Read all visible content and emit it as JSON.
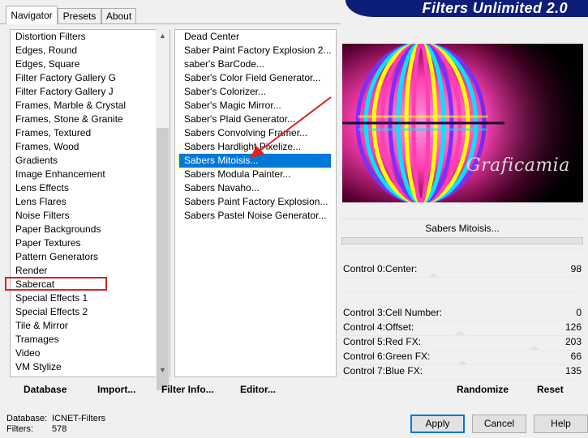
{
  "tabs": [
    "Navigator",
    "Presets",
    "About"
  ],
  "banner": "Filters Unlimited 2.0",
  "categories": [
    "Distortion Filters",
    "Edges, Round",
    "Edges, Square",
    "Filter Factory Gallery G",
    "Filter Factory Gallery J",
    "Frames, Marble & Crystal",
    "Frames, Stone & Granite",
    "Frames, Textured",
    "Frames, Wood",
    "Gradients",
    "Image Enhancement",
    "Lens Effects",
    "Lens Flares",
    "Noise Filters",
    "Paper Backgrounds",
    "Paper Textures",
    "Pattern Generators",
    "Render",
    "Sabercat",
    "Special Effects 1",
    "Special Effects 2",
    "Tile & Mirror",
    "Tramages",
    "Video",
    "VM Stylize"
  ],
  "filters": [
    "Dead Center",
    "Saber Paint Factory Explosion 2...",
    "saber's BarCode...",
    "Saber's Color Field Generator...",
    "Saber's Colorizer...",
    "Saber's Magic Mirror...",
    "Saber's Plaid Generator...",
    "Sabers Convolving Framer...",
    "Sabers Hardlight Pixelize...",
    "Sabers Mitoisis...",
    "Sabers Modula Painter...",
    "Sabers Navaho...",
    "Sabers Paint Factory Explosion...",
    "Sabers Pastel Noise Generator..."
  ],
  "selected_filter_index": 9,
  "highlighted_category": "Sabercat",
  "buttons": {
    "database": "Database",
    "import": "Import...",
    "filter_info": "Filter Info...",
    "editor": "Editor...",
    "randomize": "Randomize",
    "reset": "Reset",
    "apply": "Apply",
    "cancel": "Cancel",
    "help": "Help"
  },
  "filter_name": "Sabers Mitoisis...",
  "watermark": "Graficamia",
  "controls": [
    {
      "label": "Control 0:Center:",
      "value": "98"
    },
    {
      "label": "Control 3:Cell Number:",
      "value": "0"
    },
    {
      "label": "Control 4:Offset:",
      "value": "126"
    },
    {
      "label": "Control 5:Red FX:",
      "value": "203"
    },
    {
      "label": "Control 6:Green FX:",
      "value": "66"
    },
    {
      "label": "Control 7:Blue FX:",
      "value": "135"
    }
  ],
  "status": {
    "database_label": "Database:",
    "database_value": "ICNET-Filters",
    "filters_label": "Filters:",
    "filters_value": "578"
  },
  "colors": {
    "selection": "#0078d7",
    "banner": "#0d1d7a",
    "annotation": "#dd2222",
    "pink": "#ff3fb4",
    "cyan": "#00e5ff",
    "yellow": "#ffff00",
    "purple": "#7a30ff"
  }
}
